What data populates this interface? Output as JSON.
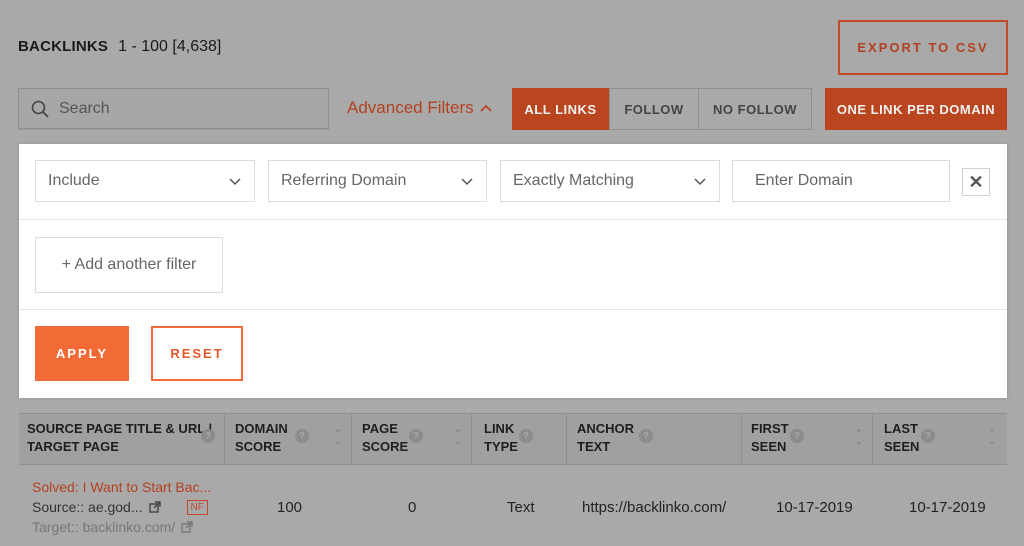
{
  "header": {
    "title": "BACKLINKS",
    "range": "1 - 100 [4,638]",
    "export_label": "EXPORT TO CSV"
  },
  "toolbar": {
    "search_placeholder": "Search",
    "advanced_filters": "Advanced Filters",
    "link_filters": [
      "ALL LINKS",
      "FOLLOW",
      "NO FOLLOW"
    ],
    "active_filter": "ALL LINKS",
    "one_link_label": "ONE LINK PER DOMAIN"
  },
  "filter_panel": {
    "include_select": "Include",
    "field_select": "Referring Domain",
    "match_select": "Exactly Matching",
    "domain_placeholder": "Enter Domain",
    "add_filter": "+ Add another filter",
    "apply": "APPLY",
    "reset": "RESET"
  },
  "table": {
    "columns": [
      {
        "line1": "SOURCE PAGE TITLE & URL |",
        "line2": "TARGET PAGE"
      },
      {
        "line1": "DOMAIN",
        "line2": "SCORE"
      },
      {
        "line1": "PAGE",
        "line2": "SCORE"
      },
      {
        "line1": "LINK",
        "line2": "TYPE"
      },
      {
        "line1": "ANCHOR",
        "line2": "TEXT"
      },
      {
        "line1": "FIRST",
        "line2": "SEEN"
      },
      {
        "line1": "LAST",
        "line2": "SEEN"
      }
    ],
    "rows": [
      {
        "source_title": "Solved: I Want to Start Bac...",
        "source_url": "Source:: ae.god...",
        "nf_badge": "NF",
        "target_url": "Target:: backlinko.com/",
        "domain_score": "100",
        "page_score": "0",
        "link_type": "Text",
        "anchor_text": "https://backlinko.com/",
        "first_seen": "10-17-2019",
        "last_seen": "10-17-2019"
      }
    ]
  },
  "colors": {
    "accent": "#f26a36",
    "accent_dim": "#b9461f",
    "overlay_bg": "#a9a9a9"
  }
}
